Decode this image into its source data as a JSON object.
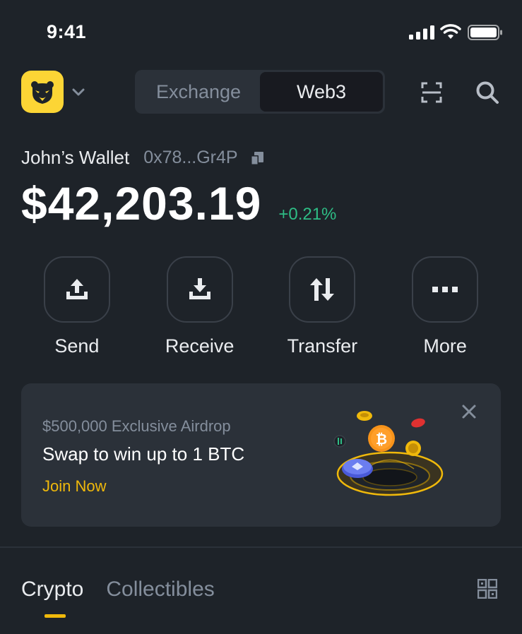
{
  "status_bar": {
    "time": "9:41"
  },
  "header": {
    "tabs": [
      {
        "label": "Exchange",
        "active": false
      },
      {
        "label": "Web3",
        "active": true
      }
    ],
    "icons": [
      "bear-logo-icon",
      "chevron-down-icon",
      "scan-icon",
      "search-icon"
    ]
  },
  "wallet": {
    "name": "John’s Wallet",
    "address": "0x78...Gr4P",
    "balance": "$42,203.19",
    "change": "+0.21%"
  },
  "actions": [
    {
      "label": "Send",
      "icon": "send-icon"
    },
    {
      "label": "Receive",
      "icon": "receive-icon"
    },
    {
      "label": "Transfer",
      "icon": "transfer-icon"
    },
    {
      "label": "More",
      "icon": "more-icon"
    }
  ],
  "banner": {
    "subtitle": "$500,000 Exclusive Airdrop",
    "title": "Swap to win up to 1 BTC",
    "cta": "Join Now"
  },
  "bottom_tabs": [
    {
      "label": "Crypto",
      "active": true
    },
    {
      "label": "Collectibles",
      "active": false
    }
  ],
  "colors": {
    "background": "#1e2329",
    "accent": "#f0b90b",
    "brand_yellow": "#fcd535",
    "positive": "#2ebd85",
    "muted": "#848e9c"
  }
}
